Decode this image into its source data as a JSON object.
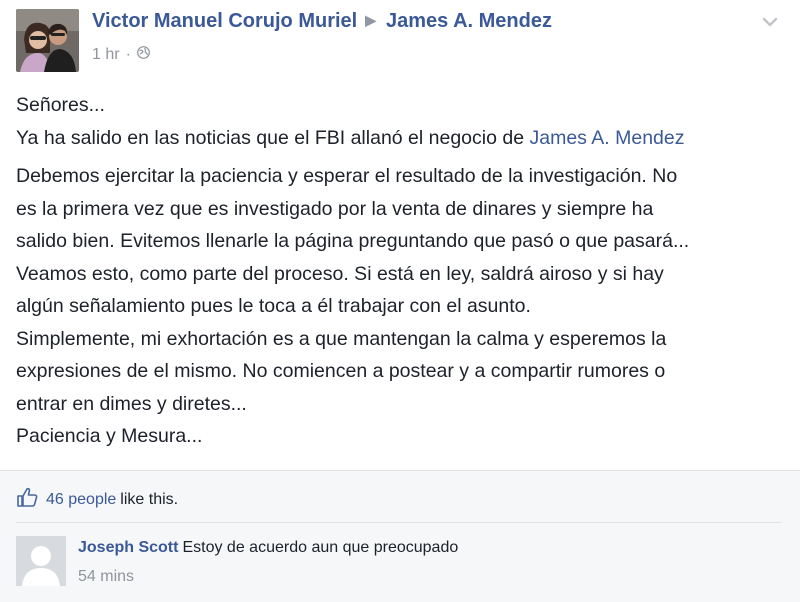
{
  "post": {
    "author": "Victor Manuel Corujo Muriel",
    "arrow": "▶",
    "target": "James A. Mendez",
    "timestamp": "1 hr",
    "dot": "·",
    "audience_icon": "globe-icon",
    "lines": [
      "Señores...",
      "Ya ha salido en las noticias que el FBI allanó el negocio de",
      "Debemos ejercitar la paciencia y esperar el resultado de la investigación. No",
      "es la primera vez que es investigado por la venta de dinares y siempre ha",
      "salido bien. Evitemos llenarle la página preguntando que pasó o que pasará...",
      "Veamos esto, como parte del proceso. Si está en ley, saldrá airoso y si hay",
      "algún señalamiento pues le toca a él trabajar con el asunto.",
      "Simplemente, mi exhortación es a que mantengan la calma y esperemos la",
      "expresiones de el mismo. No comiencen a postear y a compartir rumores o",
      "entrar en dimes y diretes...",
      "Paciencia y Mesura..."
    ],
    "mention": "James A. Mendez"
  },
  "likes": {
    "count": "46 people",
    "suffix": "like this."
  },
  "comment": {
    "author": "Joseph Scott",
    "text": "Estoy de acuerdo aun que preocupado",
    "time": "54 mins"
  },
  "colors": {
    "link": "#3b5998",
    "text": "#1d2129",
    "meta": "#90949c",
    "footer_bg": "#f6f7f9"
  }
}
